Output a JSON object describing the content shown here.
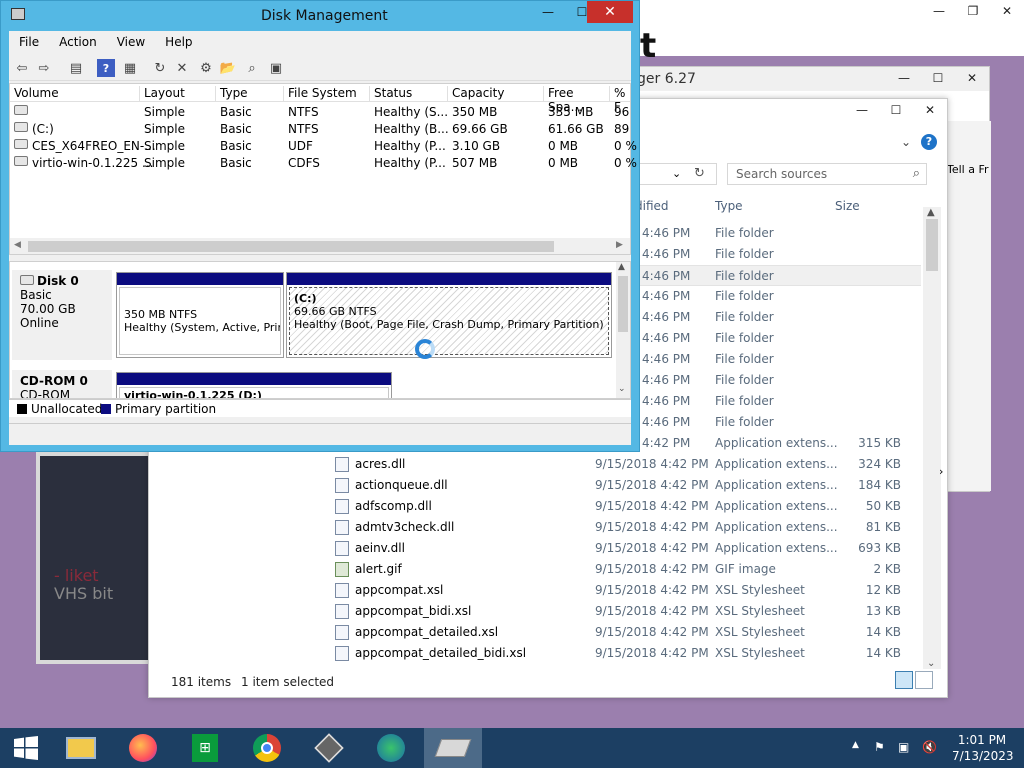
{
  "background_windows": {
    "top_partial_text": "t",
    "manager_title_partial": "ger 6.27",
    "manager_side_text": "Tell a Fr",
    "dark_window_line1": "- liket",
    "dark_window_line2": "VHS bit"
  },
  "explorer": {
    "search_placeholder": "Search sources",
    "columns": {
      "modified": "dified",
      "type": "Type",
      "size": "Size"
    },
    "rows": [
      {
        "date": "4:46 PM",
        "type": "File folder",
        "size": "",
        "selected": false
      },
      {
        "date": "4:46 PM",
        "type": "File folder",
        "size": "",
        "selected": false
      },
      {
        "date": "4:46 PM",
        "type": "File folder",
        "size": "",
        "selected": true
      },
      {
        "date": "4:46 PM",
        "type": "File folder",
        "size": "",
        "selected": false
      },
      {
        "date": "4:46 PM",
        "type": "File folder",
        "size": "",
        "selected": false
      },
      {
        "date": "4:46 PM",
        "type": "File folder",
        "size": "",
        "selected": false
      },
      {
        "date": "4:46 PM",
        "type": "File folder",
        "size": "",
        "selected": false
      },
      {
        "date": "4:46 PM",
        "type": "File folder",
        "size": "",
        "selected": false
      },
      {
        "date": "4:46 PM",
        "type": "File folder",
        "size": "",
        "selected": false
      },
      {
        "date": "4:46 PM",
        "type": "File folder",
        "size": "",
        "selected": false
      },
      {
        "date": "4:42 PM",
        "type": "Application extens...",
        "size": "315 KB",
        "selected": false
      },
      {
        "name": "acres.dll",
        "date": "9/15/2018 4:42 PM",
        "type": "Application extens...",
        "size": "324 KB",
        "selected": false
      },
      {
        "name": "actionqueue.dll",
        "date": "9/15/2018 4:42 PM",
        "type": "Application extens...",
        "size": "184 KB",
        "selected": false
      },
      {
        "name": "adfscomp.dll",
        "date": "9/15/2018 4:42 PM",
        "type": "Application extens...",
        "size": "50 KB",
        "selected": false
      },
      {
        "name": "admtv3check.dll",
        "date": "9/15/2018 4:42 PM",
        "type": "Application extens...",
        "size": "81 KB",
        "selected": false
      },
      {
        "name": "aeinv.dll",
        "date": "9/15/2018 4:42 PM",
        "type": "Application extens...",
        "size": "693 KB",
        "selected": false
      },
      {
        "name": "alert.gif",
        "date": "9/15/2018 4:42 PM",
        "type": "GIF image",
        "size": "2 KB",
        "selected": false
      },
      {
        "name": "appcompat.xsl",
        "date": "9/15/2018 4:42 PM",
        "type": "XSL Stylesheet",
        "size": "12 KB",
        "selected": false
      },
      {
        "name": "appcompat_bidi.xsl",
        "date": "9/15/2018 4:42 PM",
        "type": "XSL Stylesheet",
        "size": "13 KB",
        "selected": false
      },
      {
        "name": "appcompat_detailed.xsl",
        "date": "9/15/2018 4:42 PM",
        "type": "XSL Stylesheet",
        "size": "14 KB",
        "selected": false
      },
      {
        "name": "appcompat_detailed_bidi.xsl",
        "date": "9/15/2018 4:42 PM",
        "type": "XSL Stylesheet",
        "size": "14 KB",
        "selected": false
      }
    ],
    "status_items": "181 items",
    "status_selected": "1 item selected"
  },
  "disk_management": {
    "title": "Disk Management",
    "menu": [
      "File",
      "Action",
      "View",
      "Help"
    ],
    "toolbar_icons": [
      "back-arrow-icon",
      "forward-arrow-icon",
      "console-tree-icon",
      "help-icon",
      "properties-icon",
      "refresh-icon",
      "delete-icon",
      "settings-icon",
      "open-folder-icon",
      "search-icon",
      "export-icon"
    ],
    "columns": [
      "Volume",
      "Layout",
      "Type",
      "File System",
      "Status",
      "Capacity",
      "Free Spa...",
      "% F"
    ],
    "volumes": [
      {
        "volume": "",
        "layout": "Simple",
        "type": "Basic",
        "fs": "NTFS",
        "status": "Healthy (S...",
        "capacity": "350 MB",
        "free": "335 MB",
        "pct": "96"
      },
      {
        "volume": "(C:)",
        "layout": "Simple",
        "type": "Basic",
        "fs": "NTFS",
        "status": "Healthy (B...",
        "capacity": "69.66 GB",
        "free": "61.66 GB",
        "pct": "89"
      },
      {
        "volume": "CES_X64FREO_EN-...",
        "layout": "Simple",
        "type": "Basic",
        "fs": "UDF",
        "status": "Healthy (P...",
        "capacity": "3.10 GB",
        "free": "0 MB",
        "pct": "0 %"
      },
      {
        "volume": "virtio-win-0.1.225 ...",
        "layout": "Simple",
        "type": "Basic",
        "fs": "CDFS",
        "status": "Healthy (P...",
        "capacity": "507 MB",
        "free": "0 MB",
        "pct": "0 %"
      }
    ],
    "disk0": {
      "name": "Disk 0",
      "kind": "Basic",
      "size": "70.00 GB",
      "state": "Online",
      "part1_line1": "350 MB NTFS",
      "part1_line2": "Healthy (System, Active, Prim",
      "part2_label": "(C:)",
      "part2_line1": "69.66 GB NTFS",
      "part2_line2": "Healthy (Boot, Page File, Crash Dump, Primary Partition)"
    },
    "cdrom0": {
      "name": "CD-ROM 0",
      "kind": "CD-ROM",
      "part_label": "virtio-win-0.1.225 (D:)"
    },
    "legend": {
      "unallocated": "Unallocated",
      "primary": "Primary partition"
    },
    "colors": {
      "primary": "#0c0c80",
      "unallocated": "#000000",
      "title_bar": "#54b8e4",
      "close": "#c7302b"
    }
  },
  "taskbar": {
    "apps": [
      "start-button",
      "file-explorer",
      "firefox",
      "store",
      "chrome",
      "package",
      "download-manager",
      "disk-management"
    ],
    "time": "1:01 PM",
    "date": "7/13/2023"
  }
}
